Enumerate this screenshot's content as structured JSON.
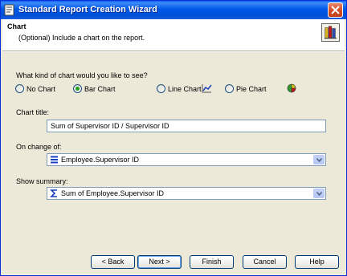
{
  "window": {
    "title": "Standard Report Creation Wizard"
  },
  "header": {
    "title": "Chart",
    "subtitle": "(Optional) Include a chart on the report."
  },
  "chart_kind": {
    "question": "What kind of chart would you like to see?",
    "options": [
      {
        "label": "No Chart",
        "checked": false
      },
      {
        "label": "Bar Chart",
        "checked": true
      },
      {
        "label": "Line Chart",
        "checked": false
      },
      {
        "label": "Pie Chart",
        "checked": false
      }
    ]
  },
  "chart_title": {
    "label": "Chart title:",
    "value": "Sum of Supervisor ID / Supervisor ID"
  },
  "on_change": {
    "label": "On change of:",
    "value": "Employee.Supervisor ID"
  },
  "show_summary": {
    "label": "Show summary:",
    "value": "Sum of Employee.Supervisor ID"
  },
  "buttons": {
    "back": "< Back",
    "next": "Next >",
    "finish": "Finish",
    "cancel": "Cancel",
    "help": "Help"
  },
  "colors": {
    "accent": "#0058e6",
    "dialog_bg": "#ece9d8",
    "close": "#d44a21"
  }
}
